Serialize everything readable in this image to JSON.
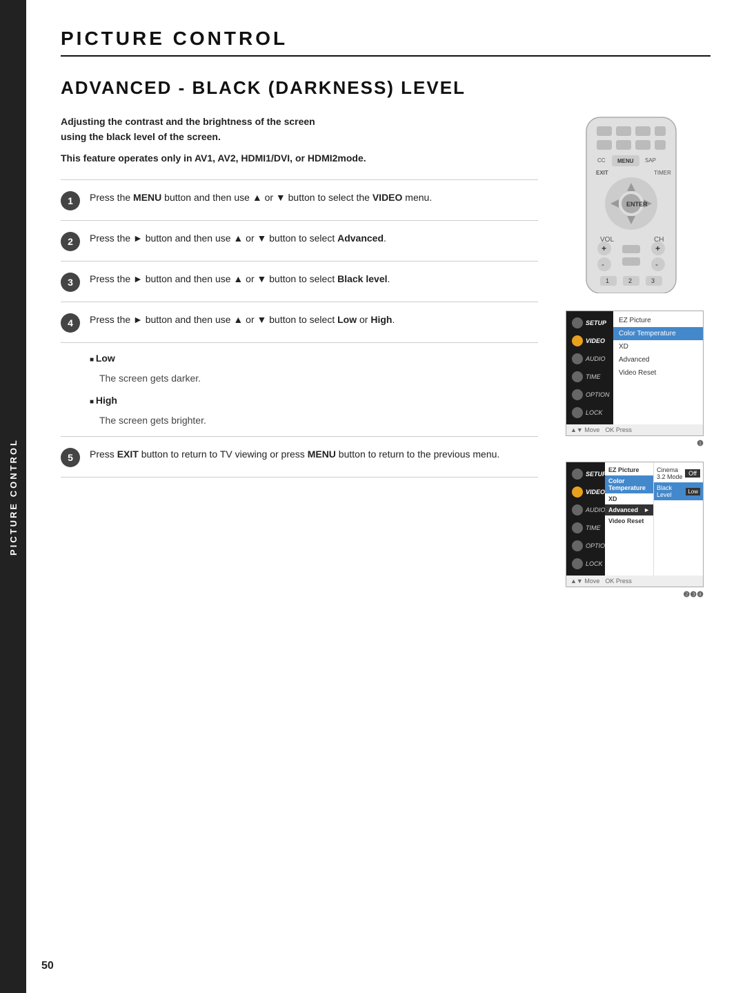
{
  "page": {
    "sidebar_label": "PICTURE CONTROL",
    "page_title": "PICTURE CONTROL",
    "section_title": "ADVANCED - BLACK (DARKNESS) LEVEL",
    "page_number": "50"
  },
  "intro": {
    "line1": "Adjusting the contrast and the brightness of the screen",
    "line2": "using the black level of the screen.",
    "note": "This feature operates only in AV1, AV2, HDMI1/DVI, or HDMI2mode."
  },
  "steps": [
    {
      "number": "1",
      "text": "Press the ",
      "bold1": "MENU",
      "mid1": " button and then use ▲ or ▼ button to select the ",
      "bold2": "VIDEO",
      "end": " menu."
    },
    {
      "number": "2",
      "text": "Press the ► button and then use ▲ or ▼ button to select ",
      "bold2": "Advanced",
      "end": "."
    },
    {
      "number": "3",
      "text": "Press the ► button and then use ▲ or ▼ button to select ",
      "bold2": "Black level",
      "end": "."
    },
    {
      "number": "4",
      "text": "Press the ► button and then use ▲ or ▼ button to select ",
      "bold2": "Low",
      "mid2": " or ",
      "bold3": "High",
      "end": "."
    },
    {
      "number": "5",
      "text": "Press ",
      "bold1": "EXIT",
      "mid1": " button to return to TV viewing or press ",
      "bold2": "MENU",
      "end": " button to return to the previous menu."
    }
  ],
  "sub_options": {
    "low_label": "Low",
    "low_desc": "The screen gets darker.",
    "high_label": "High",
    "high_desc": "The screen gets brighter."
  },
  "menu1": {
    "left_items": [
      {
        "label": "SETUP",
        "active": false
      },
      {
        "label": "VIDEO",
        "active": true
      },
      {
        "label": "AUDIO",
        "active": false
      },
      {
        "label": "TIME",
        "active": false
      },
      {
        "label": "OPTION",
        "active": false
      },
      {
        "label": "LOCK",
        "active": false
      }
    ],
    "right_items": [
      {
        "label": "EZ Picture",
        "highlighted": false
      },
      {
        "label": "Color Temperature",
        "highlighted": true
      },
      {
        "label": "XD",
        "highlighted": false
      },
      {
        "label": "Advanced",
        "highlighted": false
      },
      {
        "label": "Video Reset",
        "highlighted": false
      }
    ],
    "step_badge": "❶"
  },
  "menu2": {
    "left_items": [
      {
        "label": "SETUP",
        "active": false
      },
      {
        "label": "VIDEO",
        "active": true
      },
      {
        "label": "AUDIO",
        "active": false
      },
      {
        "label": "TIME",
        "active": false
      },
      {
        "label": "OPTION",
        "active": false
      },
      {
        "label": "LOCK",
        "active": false
      }
    ],
    "right_items": [
      {
        "label": "EZ Picture",
        "highlighted": false
      },
      {
        "label": "Color Temperature",
        "highlighted": false
      },
      {
        "label": "XD",
        "highlighted": false
      },
      {
        "label": "Advanced",
        "highlighted": true,
        "arrow": true
      },
      {
        "label": "Video Reset",
        "highlighted": false
      }
    ],
    "sub_items": [
      {
        "label": "Cinema 3.2 Mode",
        "value": "Off"
      },
      {
        "label": "Black Level",
        "value": "Low"
      }
    ],
    "step_badge": "❷❸❹"
  }
}
